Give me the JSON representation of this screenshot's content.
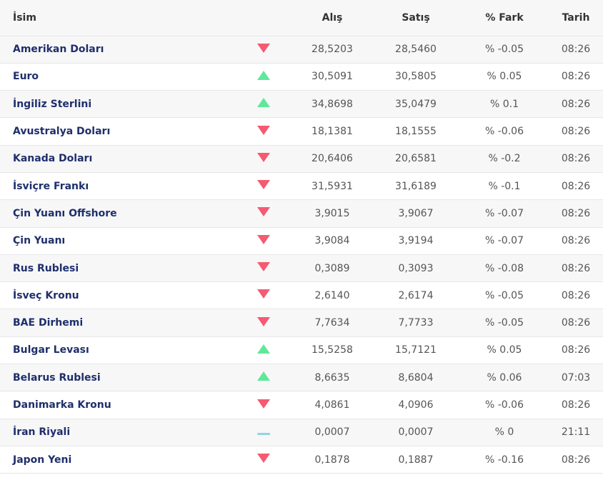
{
  "header": {
    "name": "İsim",
    "alis": "Alış",
    "satis": "Satış",
    "fark": "% Fark",
    "tarih": "Tarih"
  },
  "rows": [
    {
      "name": "Amerikan Doları",
      "trend": "down",
      "alis": "28,5203",
      "satis": "28,5460",
      "fark": "% -0.05",
      "tarih": "08:26"
    },
    {
      "name": "Euro",
      "trend": "up",
      "alis": "30,5091",
      "satis": "30,5805",
      "fark": "% 0.05",
      "tarih": "08:26"
    },
    {
      "name": "İngiliz Sterlini",
      "trend": "up",
      "alis": "34,8698",
      "satis": "35,0479",
      "fark": "% 0.1",
      "tarih": "08:26"
    },
    {
      "name": "Avustralya Doları",
      "trend": "down",
      "alis": "18,1381",
      "satis": "18,1555",
      "fark": "% -0.06",
      "tarih": "08:26"
    },
    {
      "name": "Kanada Doları",
      "trend": "down",
      "alis": "20,6406",
      "satis": "20,6581",
      "fark": "% -0.2",
      "tarih": "08:26"
    },
    {
      "name": "İsviçre Frankı",
      "trend": "down",
      "alis": "31,5931",
      "satis": "31,6189",
      "fark": "% -0.1",
      "tarih": "08:26"
    },
    {
      "name": "Çin Yuanı Offshore",
      "trend": "down",
      "alis": "3,9015",
      "satis": "3,9067",
      "fark": "% -0.07",
      "tarih": "08:26"
    },
    {
      "name": "Çin Yuanı",
      "trend": "down",
      "alis": "3,9084",
      "satis": "3,9194",
      "fark": "% -0.07",
      "tarih": "08:26"
    },
    {
      "name": "Rus Rublesi",
      "trend": "down",
      "alis": "0,3089",
      "satis": "0,3093",
      "fark": "% -0.08",
      "tarih": "08:26"
    },
    {
      "name": "İsveç Kronu",
      "trend": "down",
      "alis": "2,6140",
      "satis": "2,6174",
      "fark": "% -0.05",
      "tarih": "08:26"
    },
    {
      "name": "BAE Dirhemi",
      "trend": "down",
      "alis": "7,7634",
      "satis": "7,7733",
      "fark": "% -0.05",
      "tarih": "08:26"
    },
    {
      "name": "Bulgar Levası",
      "trend": "up",
      "alis": "15,5258",
      "satis": "15,7121",
      "fark": "% 0.05",
      "tarih": "08:26"
    },
    {
      "name": "Belarus Rublesi",
      "trend": "up",
      "alis": "8,6635",
      "satis": "8,6804",
      "fark": "% 0.06",
      "tarih": "07:03"
    },
    {
      "name": "Danimarka Kronu",
      "trend": "down",
      "alis": "4,0861",
      "satis": "4,0906",
      "fark": "% -0.06",
      "tarih": "08:26"
    },
    {
      "name": "İran Riyali",
      "trend": "flat",
      "alis": "0,0007",
      "satis": "0,0007",
      "fark": "% 0",
      "tarih": "21:11"
    },
    {
      "name": "Japon Yeni",
      "trend": "down",
      "alis": "0,1878",
      "satis": "0,1887",
      "fark": "% -0.16",
      "tarih": "08:26"
    }
  ],
  "colors": {
    "down": "#f45b73",
    "up": "#5fe89a",
    "flat": "#8fd6df",
    "name_text": "#1f2f6b"
  }
}
